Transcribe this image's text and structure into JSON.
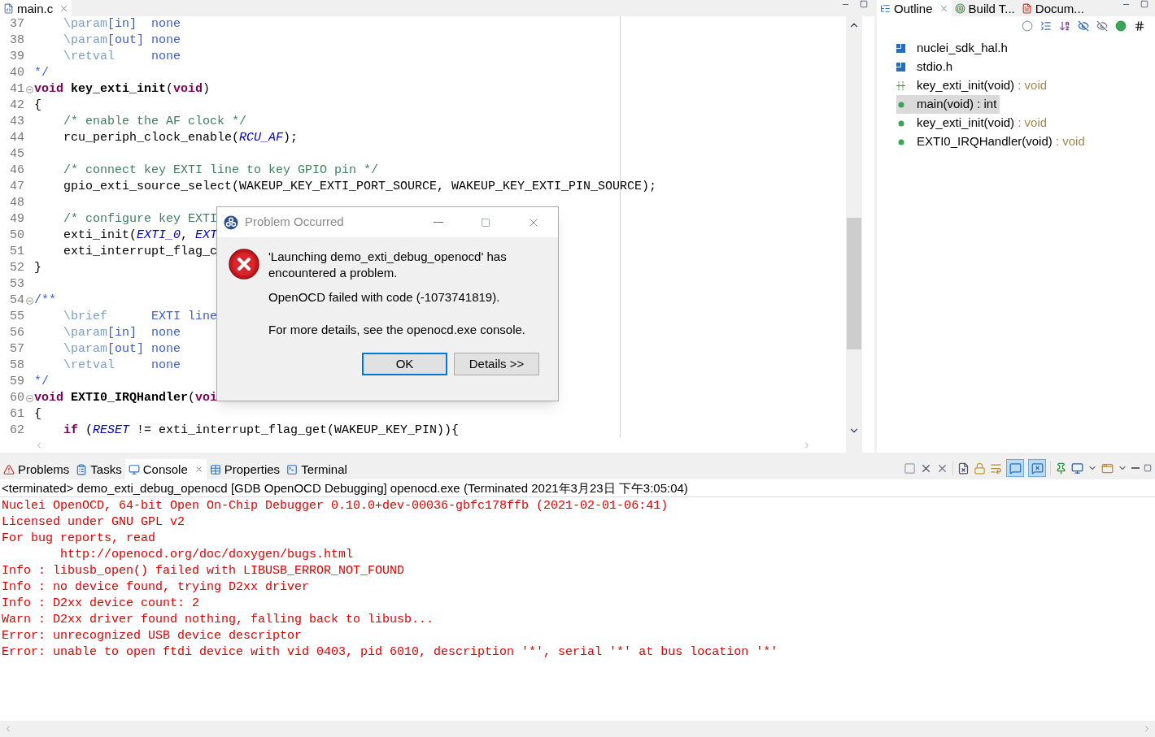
{
  "editor": {
    "tab": {
      "label": "main.c",
      "selected": true
    },
    "lines": [
      {
        "number": "37",
        "foldable": false,
        "tokens": [
          {
            "kind": "doctag",
            "text": "    \\param"
          },
          {
            "kind": "doc",
            "text": "[in]  none"
          }
        ]
      },
      {
        "number": "38",
        "foldable": false,
        "tokens": [
          {
            "kind": "doctag",
            "text": "    \\param"
          },
          {
            "kind": "doc",
            "text": "[out] none"
          }
        ]
      },
      {
        "number": "39",
        "foldable": false,
        "tokens": [
          {
            "kind": "doctag",
            "text": "    \\retval"
          },
          {
            "kind": "doc",
            "text": "     none"
          }
        ]
      },
      {
        "number": "40",
        "foldable": false,
        "tokens": [
          {
            "kind": "doc",
            "text": "*/"
          }
        ]
      },
      {
        "number": "41",
        "foldable": true,
        "tokens": [
          {
            "kind": "keyword",
            "text": "void"
          },
          {
            "kind": "function",
            "text": " key_exti_init"
          },
          {
            "kind": "plain",
            "text": "("
          },
          {
            "kind": "keyword",
            "text": "void"
          },
          {
            "kind": "plain",
            "text": ")"
          }
        ]
      },
      {
        "number": "42",
        "foldable": false,
        "tokens": [
          {
            "kind": "plain",
            "text": "{"
          }
        ]
      },
      {
        "number": "43",
        "foldable": false,
        "tokens": [
          {
            "kind": "comment",
            "text": "    /* enable the AF clock */"
          }
        ]
      },
      {
        "number": "44",
        "foldable": false,
        "tokens": [
          {
            "kind": "plain",
            "text": "    rcu_periph_clock_enable("
          },
          {
            "kind": "macro",
            "text": "RCU_AF"
          },
          {
            "kind": "plain",
            "text": ");"
          }
        ]
      },
      {
        "number": "45",
        "foldable": false
      },
      {
        "number": "46",
        "foldable": false,
        "tokens": [
          {
            "kind": "comment",
            "text": "    /* connect key EXTI line to key GPIO pin */"
          }
        ]
      },
      {
        "number": "47",
        "foldable": false,
        "tokens": [
          {
            "kind": "plain",
            "text": "    gpio_exti_source_select(WAKEUP_KEY_EXTI_PORT_SOURCE, WAKEUP_KEY_EXTI_PIN_SOURCE);"
          }
        ]
      },
      {
        "number": "48",
        "foldable": false
      },
      {
        "number": "49",
        "foldable": false,
        "tokens": [
          {
            "kind": "comment",
            "text": "    /* configure key EXTI"
          }
        ]
      },
      {
        "number": "50",
        "foldable": false,
        "tokens": [
          {
            "kind": "plain",
            "text": "    exti_init("
          },
          {
            "kind": "macro",
            "text": "EXTI_0"
          },
          {
            "kind": "plain",
            "text": ", "
          },
          {
            "kind": "macro",
            "text": "EXT"
          }
        ]
      },
      {
        "number": "51",
        "foldable": false,
        "tokens": [
          {
            "kind": "plain",
            "text": "    exti_interrupt_flag_c"
          }
        ]
      },
      {
        "number": "52",
        "foldable": false,
        "tokens": [
          {
            "kind": "plain",
            "text": "}"
          }
        ]
      },
      {
        "number": "53",
        "foldable": false
      },
      {
        "number": "54",
        "foldable": true,
        "tokens": [
          {
            "kind": "doc",
            "text": "/**"
          }
        ]
      },
      {
        "number": "55",
        "foldable": false,
        "tokens": [
          {
            "kind": "doctag",
            "text": "    \\brief"
          },
          {
            "kind": "doc",
            "text": "      EXTI line"
          }
        ]
      },
      {
        "number": "56",
        "foldable": false,
        "tokens": [
          {
            "kind": "doctag",
            "text": "    \\param"
          },
          {
            "kind": "doc",
            "text": "[in]  none"
          }
        ]
      },
      {
        "number": "57",
        "foldable": false,
        "tokens": [
          {
            "kind": "doctag",
            "text": "    \\param"
          },
          {
            "kind": "doc",
            "text": "[out] none"
          }
        ]
      },
      {
        "number": "58",
        "foldable": false,
        "tokens": [
          {
            "kind": "doctag",
            "text": "    \\retval"
          },
          {
            "kind": "doc",
            "text": "     none"
          }
        ]
      },
      {
        "number": "59",
        "foldable": false,
        "tokens": [
          {
            "kind": "doc",
            "text": "*/"
          }
        ]
      },
      {
        "number": "60",
        "foldable": true,
        "tokens": [
          {
            "kind": "keyword",
            "text": "void"
          },
          {
            "kind": "function",
            "text": " EXTI0_IRQHandler"
          },
          {
            "kind": "plain",
            "text": "("
          },
          {
            "kind": "keyword",
            "text": "voi"
          }
        ]
      },
      {
        "number": "61",
        "foldable": false,
        "tokens": [
          {
            "kind": "plain",
            "text": "{"
          }
        ]
      },
      {
        "number": "62",
        "foldable": false,
        "tokens": [
          {
            "kind": "keyword",
            "text": "    if"
          },
          {
            "kind": "plain",
            "text": " ("
          },
          {
            "kind": "macro",
            "text": "RESET"
          },
          {
            "kind": "plain",
            "text": " != exti_interrupt_flag_get(WAKEUP_KEY_PIN)){"
          }
        ]
      }
    ]
  },
  "outline": {
    "tabs": [
      {
        "label": "Outline",
        "kind": "outline",
        "selected": true
      },
      {
        "label": "Build T...",
        "kind": "build",
        "selected": false
      },
      {
        "label": "Docum...",
        "kind": "docs",
        "selected": false
      }
    ],
    "items": [
      {
        "name": "nuclei_sdk_hal.h",
        "kind": "include",
        "selected": false
      },
      {
        "name": "stdio.h",
        "kind": "include",
        "selected": false
      },
      {
        "name": "key_exti_init(void)",
        "type": ": void",
        "kind": "declaration",
        "selected": false
      },
      {
        "name": "main(void) : int",
        "kind": "function",
        "selected": true
      },
      {
        "name": "key_exti_init(void)",
        "type": ": void",
        "kind": "function",
        "selected": false
      },
      {
        "name": "EXTI0_IRQHandler(void)",
        "type": ": void",
        "kind": "function",
        "selected": false
      }
    ]
  },
  "bottom": {
    "tabs": [
      {
        "label": "Problems",
        "kind": "problems",
        "selected": false
      },
      {
        "label": "Tasks",
        "kind": "tasks",
        "selected": false
      },
      {
        "label": "Console",
        "kind": "console",
        "selected": true
      },
      {
        "label": "Properties",
        "kind": "properties",
        "selected": false
      },
      {
        "label": "Terminal",
        "kind": "terminal",
        "selected": false
      }
    ],
    "toggles": [
      {
        "kind": "stdout",
        "on": true
      },
      {
        "kind": "stderr",
        "on": true
      }
    ],
    "status": "<terminated> demo_exti_debug_openocd [GDB OpenOCD Debugging] openocd.exe (Terminated 2021年3月23日 下午3:05:04)",
    "lines": [
      {
        "kind": "error",
        "text": "Nuclei OpenOCD, 64-bit Open On-Chip Debugger 0.10.0+dev-00036-gbfc178ffb (2021-02-01-06:41)"
      },
      {
        "kind": "error",
        "text": "Licensed under GNU GPL v2"
      },
      {
        "kind": "error",
        "text": "For bug reports, read"
      },
      {
        "kind": "error",
        "text": "        http://openocd.org/doc/doxygen/bugs.html"
      },
      {
        "kind": "error",
        "text": "Info : libusb_open() failed with LIBUSB_ERROR_NOT_FOUND"
      },
      {
        "kind": "error",
        "text": "Info : no device found, trying D2xx driver"
      },
      {
        "kind": "error",
        "text": "Info : D2xx device count: 2"
      },
      {
        "kind": "error",
        "text": "Warn : D2xx driver found nothing, falling back to libusb..."
      },
      {
        "kind": "error",
        "text": "Error: unrecognized USB device descriptor"
      },
      {
        "kind": "error",
        "text": "Error: unable to open ftdi device with vid 0403, pid 6010, description '*', serial '*' at bus location '*'"
      }
    ]
  },
  "dialog": {
    "title": "Problem Occurred",
    "message": "'Launching demo_exti_debug_openocd' has encountered a problem.",
    "reason": "OpenOCD failed with code (-1073741819).",
    "hint": "For more details, see the openocd.exe console.",
    "buttons": [
      {
        "label": "OK",
        "default": true
      },
      {
        "label": "Details >>",
        "default": false
      }
    ]
  }
}
